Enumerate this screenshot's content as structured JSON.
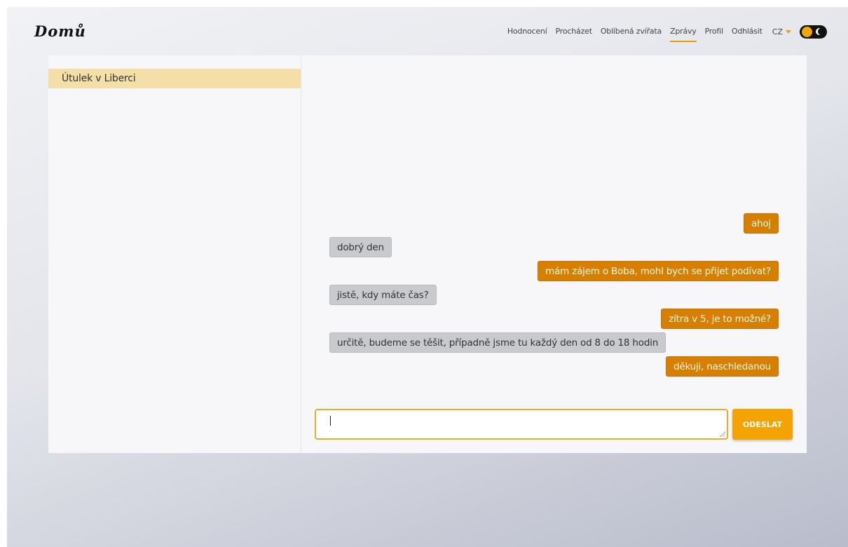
{
  "header": {
    "logo": "Domů",
    "nav": [
      {
        "label": "Hodnocení",
        "active": false
      },
      {
        "label": "Procházet",
        "active": false
      },
      {
        "label": "Oblíbená zvířata",
        "active": false
      },
      {
        "label": "Zprávy",
        "active": true
      },
      {
        "label": "Profil",
        "active": false
      },
      {
        "label": "Odhlásit",
        "active": false
      }
    ],
    "language": "CZ",
    "theme_toggle_icon": "moon-icon"
  },
  "conversations": [
    {
      "name": "Útulek v Liberci",
      "selected": true
    }
  ],
  "messages": [
    {
      "from": "me",
      "text": "ahoj"
    },
    {
      "from": "them",
      "text": "dobrý den"
    },
    {
      "from": "me",
      "text": "mám zájem o Boba, mohl bych se přijet podívat?"
    },
    {
      "from": "them",
      "text": "jistě, kdy máte čas?"
    },
    {
      "from": "me",
      "text": "zítra v 5, je to možné?"
    },
    {
      "from": "them",
      "text": "určitě, budeme se těšit, případně jsme tu každý den od 8 do 18 hodin"
    },
    {
      "from": "me",
      "text": "děkuji, naschledanou"
    }
  ],
  "composer": {
    "value": "",
    "send_label": "ODESLAT"
  },
  "colors": {
    "accent": "#f5a300",
    "my_bubble": "#d67f00",
    "their_bubble": "#c9cacd",
    "selected_conversation": "#f5dfa9"
  }
}
